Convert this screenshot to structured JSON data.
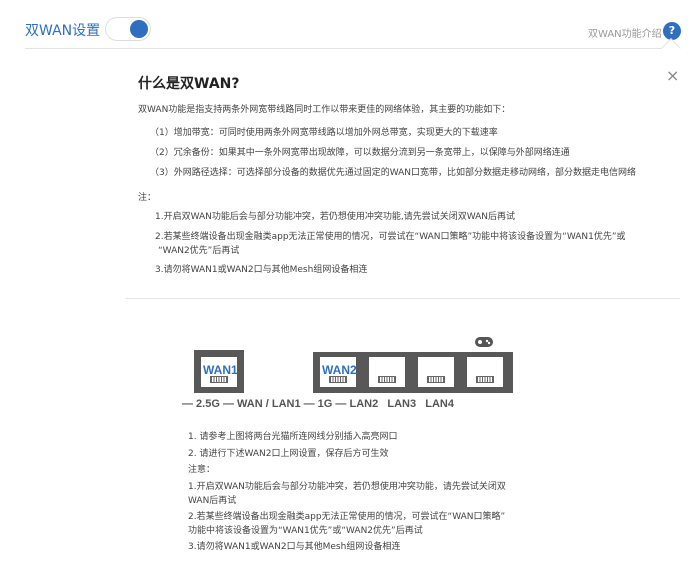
{
  "header": {
    "title": "双WAN设置",
    "toggle_on": true,
    "intro_link": "双WAN功能介绍",
    "help_icon": "?"
  },
  "popover": {
    "close_icon": "×",
    "heading": "什么是双WAN?",
    "intro": "双WAN功能是指支持两条外网宽带线路同时工作以带来更佳的网络体验，其主要的功能如下：",
    "features": [
      "（1）增加带宽：可同时使用两条外网宽带线路以增加外网总带宽，实现更大的下载速率",
      "（2）冗余备份：如果其中一条外网宽带出现故障，可以数据分流到另一条宽带上，以保障与外部网络连通",
      "（3）外网路径选择：可选择部分设备的数据优先通过固定的WAN口宽带，比如部分数据走移动网络，部分数据走电信网络"
    ],
    "note_label": "注：",
    "notes": [
      "1.开启双WAN功能后会与部分功能冲突，若仍想使用冲突功能,请先尝试关闭双WAN后再试",
      "2.若某些终端设备出现金融类app无法正常使用的情况，可尝试在“WAN口策略”功能中将该设备设置为“WAN1优先”或",
      "“WAN2优先”后再试",
      "3.请勿将WAN1或WAN2口与其他Mesh组网设备相连"
    ],
    "diagram": {
      "wan1": "WAN1",
      "wan2": "WAN2",
      "port_labels": "— 2.5G — WAN / LAN1 — 1G — LAN2   LAN3   LAN4"
    },
    "steps": [
      "1. 请参考上图将两台光猫所连网线分别插入高亮网口",
      "2. 请进行下述WAN2口上网设置，保存后方可生效",
      "注意：",
      "1.开启双WAN功能后会与部分功能冲突，若仍想使用冲突功能，请先尝试关闭双",
      "WAN后再试",
      "2.若某些终端设备出现金融类app无法正常使用的情况，可尝试在“WAN口策略”",
      "功能中将该设备设置为“WAN1优先”或“WAN2优先”后再试",
      "3.请勿将WAN1或WAN2口与其他Mesh组网设备相连"
    ]
  }
}
